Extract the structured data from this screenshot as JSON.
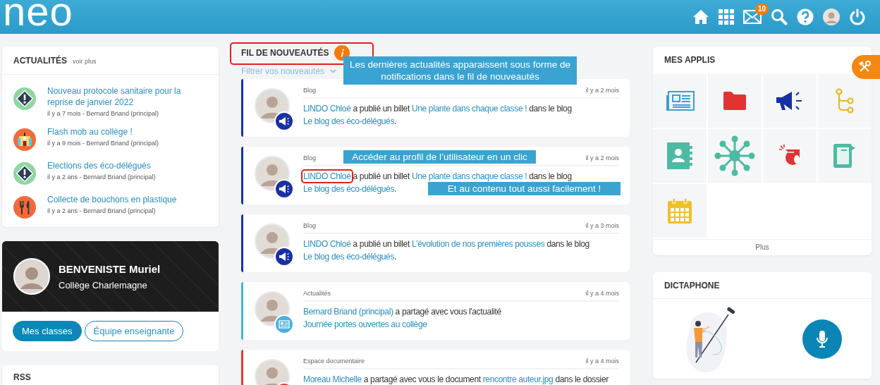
{
  "header": {
    "logo": "neo",
    "icons": [
      {
        "kind": "home"
      },
      {
        "kind": "apps"
      },
      {
        "kind": "mail",
        "badge": "10"
      },
      {
        "kind": "search"
      },
      {
        "kind": "help"
      },
      {
        "kind": "avatar"
      },
      {
        "kind": "power"
      }
    ]
  },
  "news": {
    "title": "ACTUALITÉS",
    "more": "voir plus",
    "items": [
      {
        "kind": "alert",
        "title": "Nouveau protocole sanitaire pour la reprise de janvier 2022",
        "meta": "il y a 7 mois - Bernard Briand (principal)"
      },
      {
        "kind": "school",
        "title": "Flash mob au collège !",
        "meta": "il y a 9 mois - Bernard Briand (principal)"
      },
      {
        "kind": "alert",
        "title": "Elections des éco-délégués",
        "meta": "il y a 2 ans - Bernard Briand (principal)"
      },
      {
        "kind": "food",
        "title": "Collecte de bouchons en plastique",
        "meta": "il y a 2 ans - Bernard Briand (principal)"
      }
    ]
  },
  "profile": {
    "name": "BENVENISTE Muriel",
    "school": "Collège Charlemagne",
    "buttons": [
      {
        "label": "Mes classes",
        "selected": true
      },
      {
        "label": "Équipe enseignante",
        "selected": false
      }
    ]
  },
  "rss": {
    "title": "RSS"
  },
  "feed": {
    "title": "FIL DE NOUVEAUTÉS",
    "title_highlighted": true,
    "filter": "Filtrer vos nouveautés",
    "items": [
      {
        "kind": "blog",
        "color": "#1a2fa5",
        "app": "Blog",
        "time": "il y a 2 mois",
        "parts": [
          {
            "kind": "link",
            "text": "LINDO Chloé",
            "highlighted": false
          },
          {
            "kind": "text",
            "text": " a publié un billet "
          },
          {
            "kind": "link",
            "text": "Une plante dans chaque classe !",
            "highlighted": false
          },
          {
            "kind": "text",
            "text": " dans le blog "
          },
          {
            "kind": "link",
            "text": "Le blog des éco-délégués",
            "highlighted": false
          },
          {
            "kind": "text",
            "text": "."
          }
        ]
      },
      {
        "kind": "blog",
        "color": "#1a2fa5",
        "app": "Blog",
        "time": "il y a 2 mois",
        "parts": [
          {
            "kind": "link",
            "text": "LINDO Chloé",
            "highlighted": true
          },
          {
            "kind": "text",
            "text": " a publié un billet "
          },
          {
            "kind": "link",
            "text": "Une plante dans chaque classe !",
            "highlighted": false
          },
          {
            "kind": "text",
            "text": " dans le blog "
          },
          {
            "kind": "link",
            "text": "Le blog des éco-délégués",
            "highlighted": false
          },
          {
            "kind": "text",
            "text": "."
          }
        ]
      },
      {
        "kind": "blog",
        "color": "#1a2fa5",
        "app": "Blog",
        "time": "il y a 3 mois",
        "parts": [
          {
            "kind": "link",
            "text": "LINDO Chloé",
            "highlighted": false
          },
          {
            "kind": "text",
            "text": " a publié un billet "
          },
          {
            "kind": "link",
            "text": "L'évolution de nos premières pousses",
            "highlighted": false
          },
          {
            "kind": "text",
            "text": " dans le blog "
          },
          {
            "kind": "link",
            "text": "Le blog des éco-délégués",
            "highlighted": false
          },
          {
            "kind": "text",
            "text": "."
          }
        ]
      },
      {
        "kind": "news",
        "color": "#4ab2dc",
        "app": "Actualités",
        "time": "il y a 4 mois",
        "parts": [
          {
            "kind": "link",
            "text": "Bernard Briand (principal)",
            "highlighted": false
          },
          {
            "kind": "text",
            "text": " a partagé avec vous l'actualité "
          },
          {
            "kind": "link",
            "text": "Journée portes ouvertes au collège",
            "highlighted": false
          }
        ]
      },
      {
        "kind": "doc",
        "color": "#e03a32",
        "app": "Espace documentaire",
        "time": "il y a 4 mois",
        "parts": [
          {
            "kind": "link",
            "text": "Moreau Michelle",
            "highlighted": false
          },
          {
            "kind": "text",
            "text": " a partagé avec vous le document "
          },
          {
            "kind": "link",
            "text": "rencontre auteur.jpg",
            "highlighted": false
          },
          {
            "kind": "text",
            "text": " dans le dossier"
          }
        ]
      }
    ]
  },
  "apps": {
    "title": "MES APPLIS",
    "tiles": [
      {
        "kind": "newspaper"
      },
      {
        "kind": "folder"
      },
      {
        "kind": "megaphone"
      },
      {
        "kind": "tree"
      },
      {
        "kind": "contacts"
      },
      {
        "kind": "network"
      },
      {
        "kind": "whistle"
      },
      {
        "kind": "notebook"
      },
      {
        "kind": "calendar"
      }
    ],
    "more": "Plus"
  },
  "dictaphone": {
    "title": "DICTAPHONE"
  },
  "callouts": [
    {
      "text": "Les dernières actualités apparaissent sous forme de notifications dans le fil de nouveautés"
    },
    {
      "text": "Accéder au profil de l’utilisateur en un clic"
    },
    {
      "text": "Et au contenu tout aussi facilement !"
    }
  ]
}
